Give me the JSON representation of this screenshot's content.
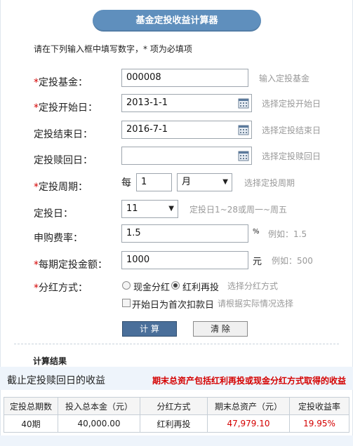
{
  "title": "基金定投收益计算器",
  "instruction": "请在下列输入框中填写数字，* 项为必填项",
  "required_mark": "*",
  "form": {
    "fund": {
      "label": "定投基金：",
      "value": "000008",
      "hint": "输入定投基金"
    },
    "start_date": {
      "label": "定投开始日：",
      "value": "2013-1-1",
      "hint": "选择定投开始日"
    },
    "end_date": {
      "label": "定投结束日：",
      "value": "2016-7-1",
      "hint": "选择定投结束日"
    },
    "redeem_date": {
      "label": "定投赎回日：",
      "value": "",
      "hint": "选择定投赎回日"
    },
    "period": {
      "label": "定投周期：",
      "prefix": "每",
      "value": "1",
      "unit": "月",
      "hint": "选择定投周期"
    },
    "day": {
      "label": "定投日：",
      "value": "11",
      "hint": "定投日1~28或周一~周五"
    },
    "fee": {
      "label": "申购费率：",
      "value": "1.5",
      "unit": "%",
      "hint": "例如：1.5"
    },
    "amount": {
      "label": "每期定投金额：",
      "value": "1000",
      "unit": "元",
      "hint": "例如：500"
    },
    "dividend": {
      "label": "分红方式：",
      "option_cash": "现金分红",
      "option_reinvest": "红利再投",
      "selected": "红利再投",
      "hint": "选择分红方式"
    },
    "first_day": {
      "label": "开始日为首次扣款日",
      "checked": false,
      "hint": "请根据实际情况选择"
    }
  },
  "buttons": {
    "calc": "计 算",
    "clear": "清 除"
  },
  "result": {
    "section_title": "计算结果",
    "banner_left": "截止定投赎回日的收益",
    "banner_right": "期末总资产包括红利再投或现金分红方式取得的收益",
    "headers": [
      "定投总期数",
      "投入总本金（元）",
      "分红方式",
      "期末总资产（元）",
      "定投收益率"
    ],
    "row": {
      "periods": "40期",
      "principal": "40,000.00",
      "dividend": "红利再投",
      "total_assets": "47,979.10",
      "return_rate": "19.95%"
    }
  },
  "colors": {
    "accent": "#5f8fbd",
    "required": "#d40000",
    "hint": "#999999"
  },
  "icons": {
    "calendar": "calendar-icon",
    "dropdown": "chevron-down-icon"
  }
}
